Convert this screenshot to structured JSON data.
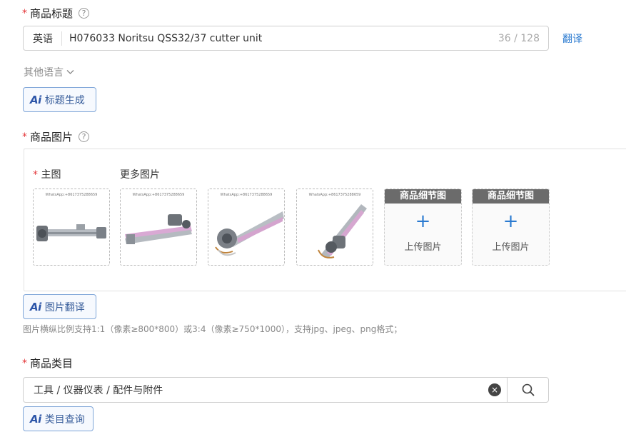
{
  "title_section": {
    "required_mark": "*",
    "label": "商品标题",
    "help": "?",
    "lang_tag": "英语",
    "value": "H076033 Noritsu QSS32/37 cutter unit",
    "count": "36 / 128",
    "translate": "翻译",
    "other_lang": "其他语言",
    "ai_logo": "Ai",
    "ai_button": "标题生成"
  },
  "image_section": {
    "required_mark": "*",
    "label": "商品图片",
    "help": "?",
    "main_required": "*",
    "main_label": "主图",
    "more_label": "更多图片",
    "watermark": "WhatsApp:+8617375288659",
    "upload_slots": [
      {
        "header": "商品细节图",
        "plus": "+",
        "text": "上传图片"
      },
      {
        "header": "商品细节图",
        "plus": "+",
        "text": "上传图片"
      }
    ],
    "ai_logo": "Ai",
    "ai_button": "图片翻译",
    "hint": "图片横纵比例支持1:1（像素≥800*800）或3:4（像素≥750*1000），支持jpg、jpeg、png格式；"
  },
  "category_section": {
    "required_mark": "*",
    "label": "商品类目",
    "value": "工具 / 仪器仪表 / 配件与附件",
    "clear": "×",
    "ai_logo": "Ai",
    "ai_button": "类目查询"
  },
  "colors": {
    "required": "#e4393c",
    "link": "#2a7ad0",
    "ai_border": "#7fa6d8"
  }
}
